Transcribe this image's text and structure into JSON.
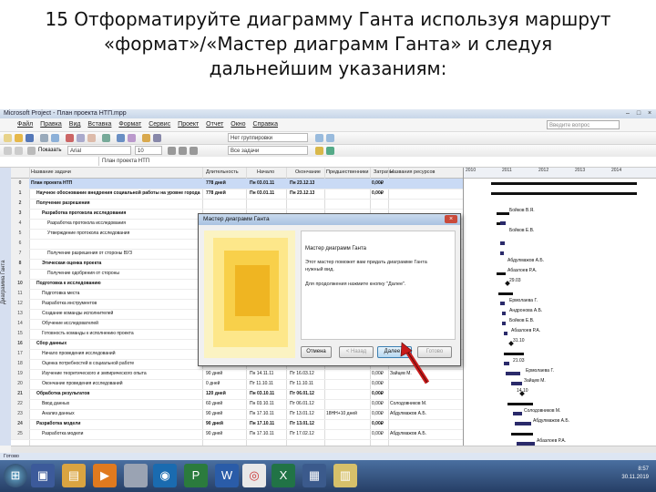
{
  "slide": {
    "line1": "15 Отформатируйте диаграмму Ганта используя маршрут",
    "line2": "«формат»/«Мастер диаграмм Ганта» и следуя",
    "line3": "дальнейшим указаниям:"
  },
  "window": {
    "title": "Microsoft Project - План проекта НТП.mpp",
    "menu": [
      "Файл",
      "Правка",
      "Вид",
      "Вставка",
      "Формат",
      "Сервис",
      "Проект",
      "Отчет",
      "Окно",
      "Справка"
    ],
    "help_placeholder": "Введите вопрос",
    "font_name": "Arial",
    "font_size": "10",
    "filter_value": "Все задачи",
    "group_value": "Нет группировки",
    "show_label": "Показать",
    "formula_value": "План проекта НТП",
    "view_label": "Диаграмма Ганта",
    "status": "Готово"
  },
  "table": {
    "headers": [
      "Название задачи",
      "Длительность",
      "Начало",
      "Окончание",
      "Предшественники",
      "Затраты",
      "Названия ресурсов"
    ],
    "rows": [
      {
        "id": "0",
        "name": "План проекта НТП",
        "dur": "778 дней",
        "start": "Пн 03.01.11",
        "end": "Пн 23.12.13",
        "pred": "",
        "cost": "0,00₽",
        "res": "",
        "level": 0,
        "summary": true
      },
      {
        "id": "1",
        "name": "Научное обоснование внедрения социальной работы на уровне города",
        "dur": "778 дней",
        "start": "Пн 03.01.11",
        "end": "Пн 23.12.13",
        "pred": "",
        "cost": "0,00₽",
        "res": "",
        "level": 1,
        "summary": true
      },
      {
        "id": "2",
        "name": "Получение разрешения",
        "dur": "",
        "start": "",
        "end": "",
        "pred": "",
        "cost": "",
        "res": "",
        "level": 1,
        "summary": true
      },
      {
        "id": "3",
        "name": "Разработка протокола исследования",
        "dur": "",
        "start": "",
        "end": "",
        "pred": "",
        "cost": "",
        "res": "",
        "level": 2,
        "summary": true
      },
      {
        "id": "4",
        "name": "Разработка протокола исследования",
        "dur": "",
        "start": "",
        "end": "",
        "pred": "",
        "cost": "",
        "res": "",
        "level": 3,
        "summary": false
      },
      {
        "id": "5",
        "name": "Утверждение протокола исследования",
        "dur": "",
        "start": "",
        "end": "",
        "pred": "",
        "cost": "",
        "res": "",
        "level": 3,
        "summary": false
      },
      {
        "id": "6",
        "name": "",
        "dur": "",
        "start": "",
        "end": "",
        "pred": "",
        "cost": "",
        "res": "",
        "level": 3,
        "summary": false
      },
      {
        "id": "7",
        "name": "Получение разрешения от стороны ВУЗ",
        "dur": "",
        "start": "",
        "end": "",
        "pred": "",
        "cost": "",
        "res": "",
        "level": 3,
        "summary": false
      },
      {
        "id": "8",
        "name": "Этическая оценка проекта",
        "dur": "",
        "start": "",
        "end": "",
        "pred": "",
        "cost": "",
        "res": "",
        "level": 2,
        "summary": true
      },
      {
        "id": "9",
        "name": "Получение одобрения от стороны",
        "dur": "",
        "start": "",
        "end": "",
        "pred": "",
        "cost": "",
        "res": "",
        "level": 3,
        "summary": false
      },
      {
        "id": "10",
        "name": "Подготовка к исследованию",
        "dur": "",
        "start": "",
        "end": "",
        "pred": "",
        "cost": "",
        "res": "",
        "level": 1,
        "summary": true
      },
      {
        "id": "11",
        "name": "Подготовка места",
        "dur": "",
        "start": "",
        "end": "",
        "pred": "",
        "cost": "",
        "res": "",
        "level": 2,
        "summary": false
      },
      {
        "id": "12",
        "name": "Разработка инструментов",
        "dur": "",
        "start": "",
        "end": "",
        "pred": "",
        "cost": "",
        "res": "",
        "level": 2,
        "summary": false
      },
      {
        "id": "13",
        "name": "Создание команды исполнителей",
        "dur": "",
        "start": "",
        "end": "",
        "pred": "",
        "cost": "",
        "res": "",
        "level": 2,
        "summary": false
      },
      {
        "id": "14",
        "name": "Обучение исследователей",
        "dur": "",
        "start": "",
        "end": "",
        "pred": "",
        "cost": "",
        "res": "",
        "level": 2,
        "summary": false
      },
      {
        "id": "15",
        "name": "Готовность команды к исполнению проекта",
        "dur": "",
        "start": "",
        "end": "",
        "pred": "",
        "cost": "",
        "res": "",
        "level": 2,
        "summary": false
      },
      {
        "id": "16",
        "name": "Сбор данных",
        "dur": "",
        "start": "",
        "end": "",
        "pred": "",
        "cost": "",
        "res": "",
        "level": 1,
        "summary": true
      },
      {
        "id": "17",
        "name": "Начало проведения исследований",
        "dur": "",
        "start": "",
        "end": "",
        "pred": "",
        "cost": "",
        "res": "",
        "level": 2,
        "summary": false
      },
      {
        "id": "18",
        "name": "Оценка потребностей в социальной работе",
        "dur": "",
        "start": "",
        "end": "",
        "pred": "",
        "cost": "",
        "res": "",
        "level": 2,
        "summary": false
      },
      {
        "id": "19",
        "name": "Изучение теоретического и эмпирического опыта",
        "dur": "90 дней",
        "start": "Пн 14.11.11",
        "end": "Пт 16.03.12",
        "pred": "",
        "cost": "0,00₽",
        "res": "Зайцев М.",
        "level": 2,
        "summary": false
      },
      {
        "id": "20",
        "name": "Окончание проведения исследований",
        "dur": "0 дней",
        "start": "Пт 11.10.11",
        "end": "Пт 11.10.11",
        "pred": "",
        "cost": "0,00₽",
        "res": "",
        "level": 2,
        "summary": false
      },
      {
        "id": "21",
        "name": "Обработка результатов",
        "dur": "120 дней",
        "start": "Пн 03.10.11",
        "end": "Пт 06.01.12",
        "pred": "",
        "cost": "0,00₽",
        "res": "",
        "level": 1,
        "summary": true
      },
      {
        "id": "22",
        "name": "Ввод данных",
        "dur": "60 дней",
        "start": "Пн 03.10.11",
        "end": "Пт 06.01.12",
        "pred": "",
        "cost": "0,00₽",
        "res": "Солодовников М.",
        "level": 2,
        "summary": false
      },
      {
        "id": "23",
        "name": "Анализ данных",
        "dur": "90 дней",
        "start": "Пн 17.10.11",
        "end": "Пт 13.01.12",
        "pred": "18НН+10 дней",
        "cost": "0,00₽",
        "res": "Абдулмажов А.Б.",
        "level": 2,
        "summary": false
      },
      {
        "id": "24",
        "name": "Разработка модели",
        "dur": "90 дней",
        "start": "Пн 17.10.11",
        "end": "Пт 13.01.12",
        "pred": "",
        "cost": "0,00₽",
        "res": "",
        "level": 1,
        "summary": true
      },
      {
        "id": "25",
        "name": "Разработка модели",
        "dur": "90 дней",
        "start": "Пн 17.10.11",
        "end": "Пт 17.02.12",
        "pred": "",
        "cost": "0,00₽",
        "res": "Абдулмажов А.Б.",
        "level": 2,
        "summary": false
      }
    ]
  },
  "gantt": {
    "years": [
      "2010",
      "2011",
      "2012",
      "2013",
      "2014"
    ],
    "labels": [
      {
        "row": 3,
        "text": "Бойков В.Я."
      },
      {
        "row": 5,
        "text": "Бойков Е.В."
      },
      {
        "row": 8,
        "text": "Абдулмажов А.Б."
      },
      {
        "row": 9,
        "text": "Абазлоев Р.А."
      },
      {
        "row": 10,
        "text": "29.03"
      },
      {
        "row": 12,
        "text": "Ермолаева Г."
      },
      {
        "row": 13,
        "text": "Андронова А.Б."
      },
      {
        "row": 14,
        "text": "Бойков Е.В."
      },
      {
        "row": 15,
        "text": "Абазлоев Р.А."
      },
      {
        "row": 16,
        "text": "31.10"
      },
      {
        "row": 18,
        "text": "21.03"
      },
      {
        "row": 19,
        "text": "Ермолаева Г."
      },
      {
        "row": 20,
        "text": "Зайцев М."
      },
      {
        "row": 21,
        "text": "14.10"
      },
      {
        "row": 23,
        "text": "Солодовников М."
      },
      {
        "row": 24,
        "text": "Абдулмажов А.Б."
      },
      {
        "row": 26,
        "text": "Абазлоев Р.А."
      }
    ]
  },
  "dialog": {
    "title": "Мастер диаграмм Ганта",
    "heading": "Мастер диаграмм Ганта",
    "description": "Этот мастер поможет вам придать диаграмме Ганта нужный вид.",
    "instruction": "Для продолжения нажмите кнопку \"Далее\".",
    "btn_cancel": "Отмена",
    "btn_back": "< Назад",
    "btn_next": "Далее >",
    "btn_finish": "Готово"
  },
  "taskbar": {
    "time": "8:57",
    "date": "30.11.2019",
    "apps": [
      "start",
      "save",
      "folder",
      "media",
      "hp",
      "word",
      "project",
      "chrome",
      "excel",
      "doc",
      "explorer"
    ]
  },
  "colors": {
    "arrow": "#c81a1a",
    "gantt_bar": "#2a2a6a",
    "highlight": "#c9daf5"
  }
}
